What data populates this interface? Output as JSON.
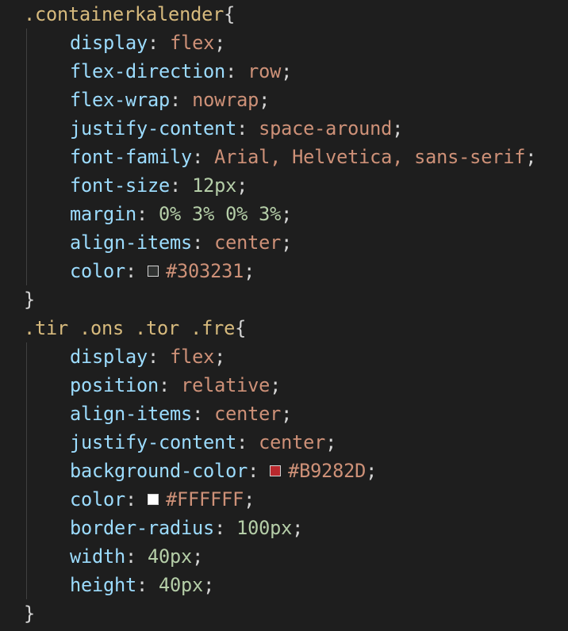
{
  "code": {
    "block1": {
      "selector": ".containerkalender",
      "open_brace": "{",
      "close_brace": "}",
      "lines": [
        {
          "prop": "display",
          "value": "flex",
          "vtype": "val"
        },
        {
          "prop": "flex-direction",
          "value": "row",
          "vtype": "val"
        },
        {
          "prop": "flex-wrap",
          "value": "nowrap",
          "vtype": "val"
        },
        {
          "prop": "justify-content",
          "value": "space-around",
          "vtype": "val"
        },
        {
          "prop": "font-family",
          "value": "Arial, Helvetica, sans-serif",
          "vtype": "val"
        },
        {
          "prop": "font-size",
          "value": "12px",
          "vtype": "num"
        },
        {
          "prop": "margin",
          "value": "0% 3% 0% 3%",
          "vtype": "num"
        },
        {
          "prop": "align-items",
          "value": "center",
          "vtype": "val"
        },
        {
          "prop": "color",
          "value": "#303231",
          "vtype": "val",
          "swatch": "#303231"
        }
      ]
    },
    "block2": {
      "selector": ".tir .ons .tor .fre",
      "open_brace": "{",
      "close_brace": "}",
      "lines": [
        {
          "prop": "display",
          "value": "flex",
          "vtype": "val"
        },
        {
          "prop": "position",
          "value": "relative",
          "vtype": "val"
        },
        {
          "prop": "align-items",
          "value": "center",
          "vtype": "val"
        },
        {
          "prop": "justify-content",
          "value": "center",
          "vtype": "val"
        },
        {
          "prop": "background-color",
          "value": "#B9282D",
          "vtype": "val",
          "swatch": "#B9282D"
        },
        {
          "prop": "color",
          "value": "#FFFFFF",
          "vtype": "val",
          "swatch": "#FFFFFF"
        },
        {
          "prop": "border-radius",
          "value": "100px",
          "vtype": "num"
        },
        {
          "prop": "width",
          "value": "40px",
          "vtype": "num"
        },
        {
          "prop": "height",
          "value": "40px",
          "vtype": "num"
        }
      ]
    }
  }
}
